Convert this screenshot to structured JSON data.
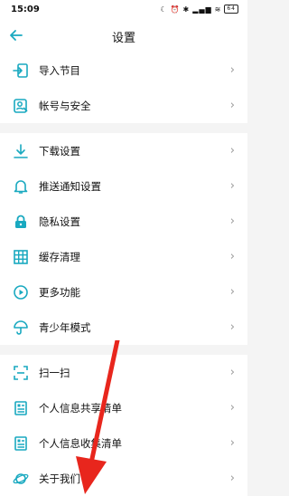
{
  "status": {
    "time": "15:09",
    "battery": "64"
  },
  "header": {
    "title": "设置"
  },
  "groups": [
    {
      "items": [
        {
          "label": "导入节目",
          "icon": "import-icon"
        },
        {
          "label": "帐号与安全",
          "icon": "account-security-icon"
        }
      ]
    },
    {
      "items": [
        {
          "label": "下载设置",
          "icon": "download-icon"
        },
        {
          "label": "推送通知设置",
          "icon": "bell-icon"
        },
        {
          "label": "隐私设置",
          "icon": "lock-icon"
        },
        {
          "label": "缓存清理",
          "icon": "grid-icon"
        },
        {
          "label": "更多功能",
          "icon": "play-circle-icon"
        },
        {
          "label": "青少年模式",
          "icon": "umbrella-icon"
        }
      ]
    },
    {
      "items": [
        {
          "label": "扫一扫",
          "icon": "scan-icon"
        },
        {
          "label": "个人信息共享清单",
          "icon": "document-list-icon"
        },
        {
          "label": "个人信息收集清单",
          "icon": "document-list-icon"
        },
        {
          "label": "关于我们",
          "icon": "planet-icon"
        }
      ]
    }
  ],
  "colors": {
    "accent": "#19a9c0",
    "annotation_arrow": "#e8261d"
  }
}
